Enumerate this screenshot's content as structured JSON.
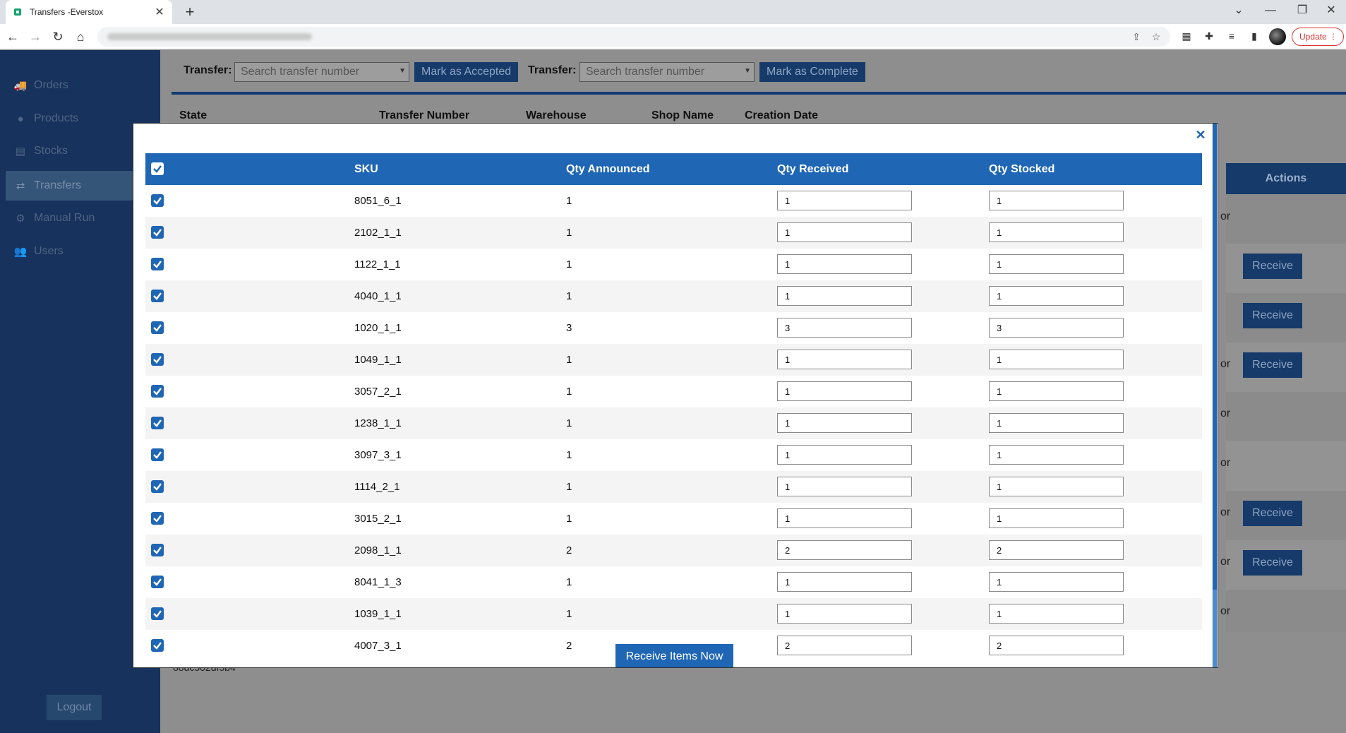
{
  "browser": {
    "tab_title": "Transfers -Everstox",
    "update_label": "Update"
  },
  "sidebar": {
    "items": [
      {
        "label": "Orders",
        "icon": "truck-icon"
      },
      {
        "label": "Products",
        "icon": "product-icon"
      },
      {
        "label": "Stocks",
        "icon": "warehouse-icon"
      },
      {
        "label": "Transfers",
        "icon": "transfer-icon"
      },
      {
        "label": "Manual Run",
        "icon": "gear-icon"
      },
      {
        "label": "Users",
        "icon": "users-icon"
      }
    ],
    "active": "Transfers",
    "logout_label": "Logout"
  },
  "filterbar": {
    "accept_label": "Transfer:",
    "accept_placeholder": "Search transfer number",
    "accept_button": "Mark as Accepted",
    "complete_label": "Transfer:",
    "complete_placeholder": "Search transfer number",
    "complete_button": "Mark as Complete"
  },
  "background_table": {
    "headers": [
      "State",
      "Transfer Number",
      "Warehouse",
      "Shop Name",
      "Creation Date"
    ],
    "actions_header": "Actions",
    "or_text": "or",
    "receive_label": "Receive",
    "bottom_text": "88dc502df5b4"
  },
  "modal": {
    "columns": [
      "SKU",
      "Qty Announced",
      "Qty Received",
      "Qty Stocked"
    ],
    "rows": [
      {
        "sku": "8051_6_1",
        "announced": "1",
        "received": "1",
        "stocked": "1"
      },
      {
        "sku": "2102_1_1",
        "announced": "1",
        "received": "1",
        "stocked": "1"
      },
      {
        "sku": "1122_1_1",
        "announced": "1",
        "received": "1",
        "stocked": "1"
      },
      {
        "sku": "4040_1_1",
        "announced": "1",
        "received": "1",
        "stocked": "1"
      },
      {
        "sku": "1020_1_1",
        "announced": "3",
        "received": "3",
        "stocked": "3"
      },
      {
        "sku": "1049_1_1",
        "announced": "1",
        "received": "1",
        "stocked": "1"
      },
      {
        "sku": "3057_2_1",
        "announced": "1",
        "received": "1",
        "stocked": "1"
      },
      {
        "sku": "1238_1_1",
        "announced": "1",
        "received": "1",
        "stocked": "1"
      },
      {
        "sku": "3097_3_1",
        "announced": "1",
        "received": "1",
        "stocked": "1"
      },
      {
        "sku": "1114_2_1",
        "announced": "1",
        "received": "1",
        "stocked": "1"
      },
      {
        "sku": "3015_2_1",
        "announced": "1",
        "received": "1",
        "stocked": "1"
      },
      {
        "sku": "2098_1_1",
        "announced": "2",
        "received": "2",
        "stocked": "2"
      },
      {
        "sku": "8041_1_3",
        "announced": "1",
        "received": "1",
        "stocked": "1"
      },
      {
        "sku": "1039_1_1",
        "announced": "1",
        "received": "1",
        "stocked": "1"
      },
      {
        "sku": "4007_3_1",
        "announced": "2",
        "received": "2",
        "stocked": "2"
      }
    ],
    "submit_label": "Receive Items Now",
    "close_icon": "close-icon"
  }
}
